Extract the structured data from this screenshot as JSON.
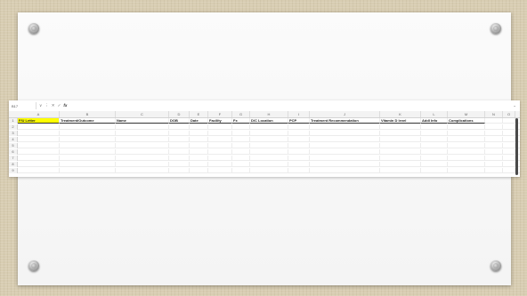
{
  "formula_bar": {
    "name_box": "B17",
    "controls": [
      "∨",
      "⋮",
      "✕",
      "✓",
      "fx"
    ],
    "expand_icon": "chevron-down"
  },
  "columns": [
    {
      "letter": "A",
      "header": "F/U Letter",
      "highlight": true
    },
    {
      "letter": "B",
      "header": "Treatment/Outcome",
      "highlight": false
    },
    {
      "letter": "C",
      "header": "Name",
      "highlight": false
    },
    {
      "letter": "D",
      "header": "DOB",
      "highlight": false
    },
    {
      "letter": "E",
      "header": "Date",
      "highlight": false
    },
    {
      "letter": "F",
      "header": "Facility",
      "highlight": false
    },
    {
      "letter": "G",
      "header": "Fx",
      "highlight": false
    },
    {
      "letter": "H",
      "header": "D/C Location",
      "highlight": false
    },
    {
      "letter": "I",
      "header": "PCP",
      "highlight": false
    },
    {
      "letter": "J",
      "header": "Treatment Recommendation",
      "highlight": false
    },
    {
      "letter": "K",
      "header": "Vitamin D level",
      "highlight": false
    },
    {
      "letter": "L",
      "header": "Addl Info",
      "highlight": false
    },
    {
      "letter": "M",
      "header": "Complications",
      "highlight": false
    },
    {
      "letter": "N",
      "header": "",
      "highlight": false
    },
    {
      "letter": "O",
      "header": "",
      "highlight": false
    }
  ],
  "row_numbers": [
    "1",
    "2",
    "3",
    "4",
    "5",
    "6",
    "7",
    "8",
    "9"
  ],
  "colors": {
    "highlight": "#ffff00",
    "board": "#f7f7f7",
    "background": "#d8cdb2"
  }
}
